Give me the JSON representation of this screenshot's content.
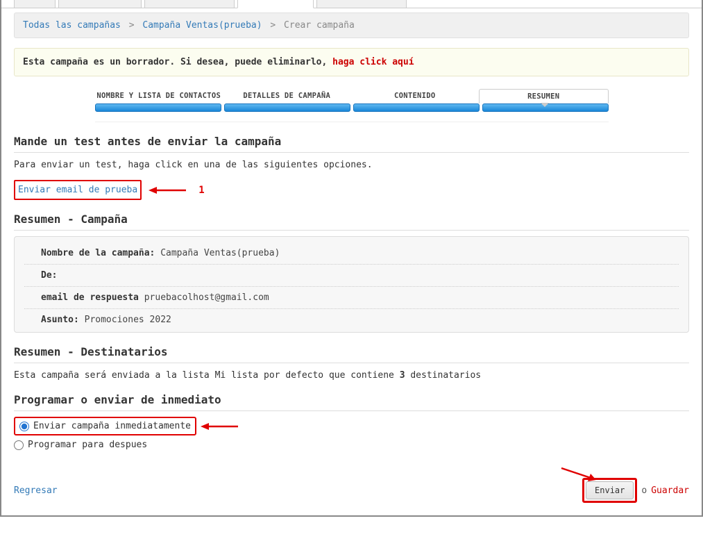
{
  "breadcrumb": {
    "all": "Todas las campañas",
    "campaign": "Campaña Ventas(prueba)",
    "current": "Crear campaña"
  },
  "draft_notice": {
    "text": "Esta campaña es un borrador. Si desea, puede eliminarlo, ",
    "action": "haga click aquí"
  },
  "wizard": {
    "step1": "NOMBRE Y LISTA DE CONTACTOS",
    "step2": "DETALLES DE CAMPAÑA",
    "step3": "CONTENIDO",
    "step4": "RESUMEN"
  },
  "test_section": {
    "title": "Mande un test antes de enviar la campaña",
    "instruction": "Para enviar un test, haga click en una de las siguientes opciones.",
    "link": "Enviar email de prueba",
    "annot_num": "1"
  },
  "summary_campaign": {
    "title": "Resumen - Campaña",
    "name_label": "Nombre de la campaña:",
    "name_value": "Campaña Ventas(prueba)",
    "from_label": "De:",
    "from_value": "",
    "reply_label": "email de respuesta",
    "reply_value": "pruebacolhost@gmail.com",
    "subject_label": "Asunto:",
    "subject_value": "Promociones 2022"
  },
  "summary_recipients": {
    "title": "Resumen - Destinatarios",
    "text_pre": "Esta campaña será enviada a la lista Mi lista por defecto que contiene ",
    "count": "3",
    "text_post": " destinatarios"
  },
  "schedule": {
    "title": "Programar o enviar de inmediato",
    "opt_now": "Enviar campaña inmediatamente",
    "opt_later": "Programar para despues"
  },
  "footer": {
    "back": "Regresar",
    "send": "Enviar",
    "or": "o",
    "save": "Guardar"
  }
}
